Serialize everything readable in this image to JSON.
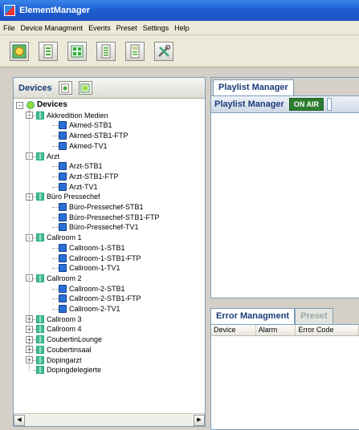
{
  "window": {
    "title": "ElementManager"
  },
  "menu": [
    "File",
    "Device Managment",
    "Events",
    "Preset",
    "Settings",
    "Help"
  ],
  "toolbar": {
    "buttons": [
      "play-device-icon",
      "list-add-icon",
      "grid-icon",
      "list-icon",
      "ip-list-icon",
      "tools-icon"
    ]
  },
  "devices": {
    "title": "Devices",
    "tree": [
      {
        "label": "Devices",
        "level": 0,
        "type": "root",
        "expand": "-"
      },
      {
        "label": "Akkredition Medien",
        "level": 1,
        "type": "group",
        "expand": "-"
      },
      {
        "label": "Akmed-STB1",
        "level": 2,
        "type": "device"
      },
      {
        "label": "Akmed-STB1-FTP",
        "level": 2,
        "type": "device"
      },
      {
        "label": "Akmed-TV1",
        "level": 2,
        "type": "device"
      },
      {
        "label": "Arzt",
        "level": 1,
        "type": "group",
        "expand": "-"
      },
      {
        "label": "Arzt-STB1",
        "level": 2,
        "type": "device"
      },
      {
        "label": "Arzt-STB1-FTP",
        "level": 2,
        "type": "device"
      },
      {
        "label": "Arzt-TV1",
        "level": 2,
        "type": "device"
      },
      {
        "label": "Büro Pressechef",
        "level": 1,
        "type": "group",
        "expand": "-"
      },
      {
        "label": "Büro-Pressechef-STB1",
        "level": 2,
        "type": "device"
      },
      {
        "label": "Büro-Pressechef-STB1-FTP",
        "level": 2,
        "type": "device"
      },
      {
        "label": "Büro-Pressechef-TV1",
        "level": 2,
        "type": "device"
      },
      {
        "label": "Callroom 1",
        "level": 1,
        "type": "group",
        "expand": "-"
      },
      {
        "label": "Callroom-1-STB1",
        "level": 2,
        "type": "device"
      },
      {
        "label": "Callroom-1-STB1-FTP",
        "level": 2,
        "type": "device"
      },
      {
        "label": "Callroom-1-TV1",
        "level": 2,
        "type": "device"
      },
      {
        "label": "Callroom 2",
        "level": 1,
        "type": "group",
        "expand": "-"
      },
      {
        "label": "Callroom-2-STB1",
        "level": 2,
        "type": "device"
      },
      {
        "label": "Callroom-2-STB1-FTP",
        "level": 2,
        "type": "device"
      },
      {
        "label": "Callroom-2-TV1",
        "level": 2,
        "type": "device"
      },
      {
        "label": "Callroom 3",
        "level": 1,
        "type": "group",
        "expand": "+"
      },
      {
        "label": "Callroom 4",
        "level": 1,
        "type": "group",
        "expand": "+"
      },
      {
        "label": "CoubertinLounge",
        "level": 1,
        "type": "group",
        "expand": "+"
      },
      {
        "label": "Coubertinsaal",
        "level": 1,
        "type": "group",
        "expand": "+"
      },
      {
        "label": "Dopingarzt",
        "level": 1,
        "type": "group",
        "expand": "+"
      },
      {
        "label": "Dopingdelegierte",
        "level": 1,
        "type": "group",
        "expand": ""
      }
    ]
  },
  "playlist": {
    "tab": "Playlist Manager",
    "header": "Playlist Manager",
    "status": "ON AIR"
  },
  "errors": {
    "tab_active": "Error Managment",
    "tab_inactive": "Preset",
    "columns": [
      "Device",
      "Alarm",
      "Error Code"
    ]
  },
  "colors": {
    "titlebar": "#1f5fd2",
    "onair": "#2e7d32",
    "header_text": "#1a3d7a"
  }
}
